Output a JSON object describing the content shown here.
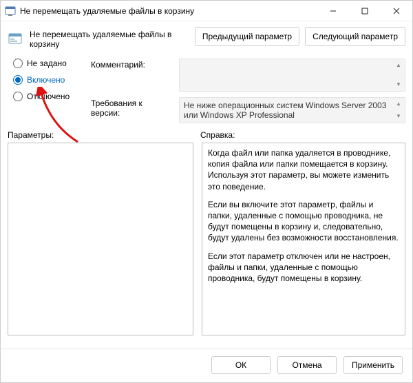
{
  "window": {
    "title": "Не перемещать удаляемые файлы в корзину"
  },
  "page": {
    "title": "Не перемещать удаляемые файлы в корзину",
    "prev_btn": "Предыдущий параметр",
    "next_btn": "Следующий параметр"
  },
  "radios": {
    "not_configured": "Не задано",
    "enabled": "Включено",
    "disabled": "Отключено"
  },
  "fields": {
    "comment_label": "Комментарий:",
    "version_label": "Требования к версии:",
    "version_text": "Не ниже операционных систем Windows Server 2003 или Windows XP Professional"
  },
  "labels": {
    "params": "Параметры:",
    "help": "Справка:"
  },
  "help": {
    "p1": "Когда файл или папка удаляется в проводнике, копия файла или папки помещается в корзину. Используя этот параметр, вы можете изменить это поведение.",
    "p2": "Если вы включите этот параметр, файлы и папки, удаленные с помощью проводника, не будут помещены в корзину и, следовательно, будут удалены без возможности восстановления.",
    "p3": "Если этот параметр отключен или не настроен, файлы и папки, удаленные с помощью проводника, будут помещены в корзину."
  },
  "buttons": {
    "ok": "ОК",
    "cancel": "Отмена",
    "apply": "Применить"
  }
}
